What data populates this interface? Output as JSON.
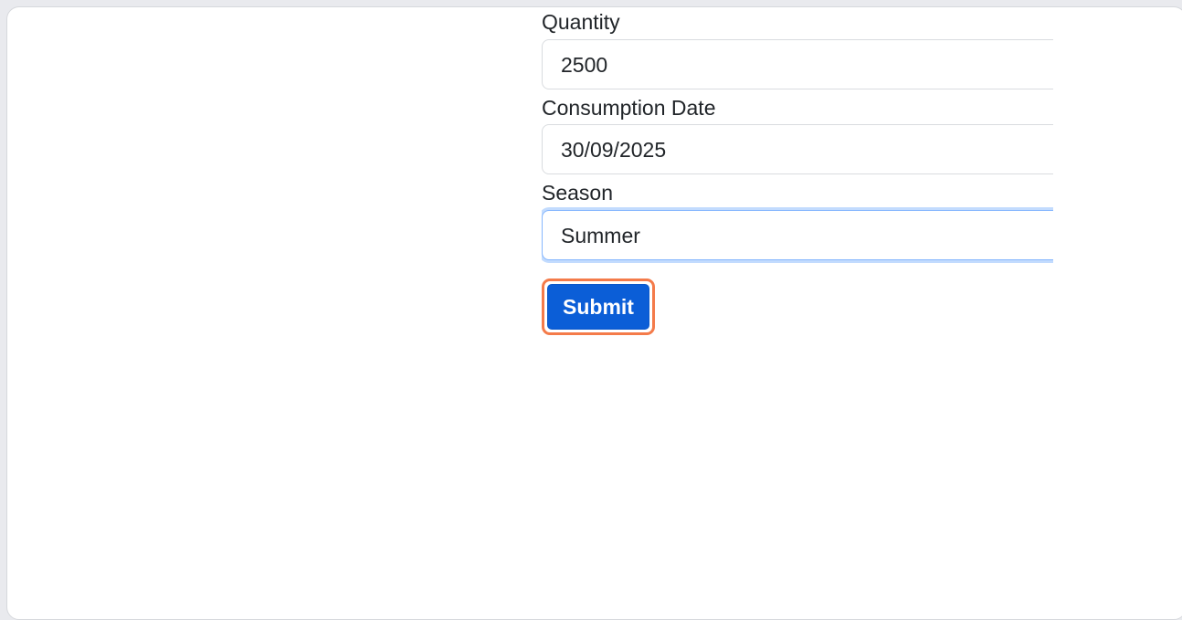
{
  "form": {
    "quantity_label": "Quantity",
    "quantity_value": "2500",
    "consumption_date_label": "Consumption Date",
    "consumption_date_value": "30/09/2025",
    "season_label": "Season",
    "season_value": "Summer",
    "submit_label": "Submit"
  },
  "colors": {
    "submit_bg": "#0b5ed7",
    "highlight": "#f47b4a",
    "focus_ring": "#86b7fe"
  }
}
